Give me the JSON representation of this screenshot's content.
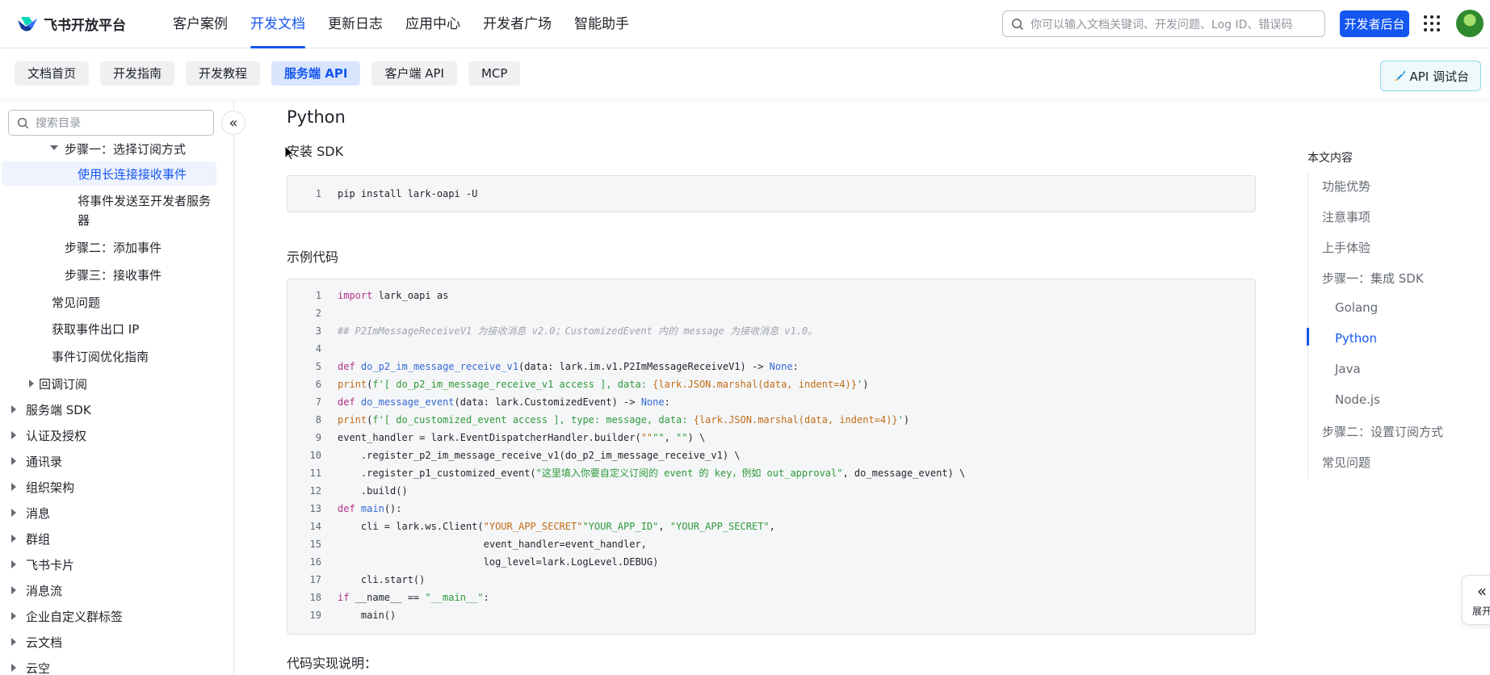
{
  "header": {
    "logo_text": "飞书开放平台",
    "nav": [
      "客户案例",
      "开发文档",
      "更新日志",
      "应用中心",
      "开发者广场",
      "智能助手"
    ],
    "active_nav": "开发文档",
    "search_placeholder": "你可以输入文档关键词、开发问题、Log ID、错误码",
    "console_button": "开发者后台",
    "accent_color": "#1456f0"
  },
  "subnav": {
    "tabs": [
      "文档首页",
      "开发指南",
      "开发教程",
      "服务端 API",
      "客户端 API",
      "MCP"
    ],
    "active_tab": "服务端 API",
    "api_debug_button": "API 调试台"
  },
  "sidebar": {
    "search_placeholder": "搜索目录",
    "items": [
      {
        "label": "步骤一：选择订阅方式",
        "expanded": true
      },
      {
        "label": "使用长连接接收事件",
        "selected": true
      },
      {
        "label": "将事件发送至开发者服务",
        "label_cont": "器"
      },
      {
        "label": "步骤二：添加事件"
      },
      {
        "label": "步骤三：接收事件"
      },
      {
        "label": "常见问题"
      },
      {
        "label": "获取事件出口 IP"
      },
      {
        "label": "事件订阅优化指南"
      },
      {
        "label": "回调订阅"
      },
      {
        "label": "服务端 SDK"
      },
      {
        "label": "认证及授权"
      },
      {
        "label": "通讯录"
      },
      {
        "label": "组织架构"
      },
      {
        "label": "消息"
      },
      {
        "label": "群组"
      },
      {
        "label": "飞书卡片"
      },
      {
        "label": "消息流"
      },
      {
        "label": "企业自定义群标签"
      },
      {
        "label": "云文档"
      },
      {
        "label": "云空"
      }
    ]
  },
  "content": {
    "section_title": "Python",
    "install_heading": "安装 SDK",
    "install_code": [
      {
        "no": "1",
        "text": "pip install lark-oapi -U"
      }
    ],
    "example_heading": "示例代码",
    "example_code": [
      {
        "no": "1",
        "a": "import",
        "b": " lark_oapi ",
        "c": "as",
        "d": " lark"
      },
      {
        "no": "2"
      },
      {
        "no": "3",
        "comment": "## P2ImMessageReceiveV1 为接收消息 v2.0；CustomizedEvent 内的 message 为接收消息 v1.0。"
      },
      {
        "no": "4"
      },
      {
        "no": "5",
        "a": "def",
        "fn": "do_p2_im_message_receive_v1",
        "b": "(data: lark.im.v1.P2ImMessageReceiveV1) -> ",
        "none": "None",
        "c": ":"
      },
      {
        "no": "6",
        "bi": "print",
        "b": "(",
        "s1": "f'[ do_p2_im_message_receive_v1 access ], data: ",
        "s2": "{lark.JSON.marshal(data, indent=4)}",
        "s3": "'",
        "c": ")"
      },
      {
        "no": "7",
        "a": "def",
        "fn": "do_message_event",
        "b": "(data: lark.CustomizedEvent) -> ",
        "none": "None",
        "c": ":"
      },
      {
        "no": "8",
        "bi": "print",
        "b": "(",
        "s1": "f'[ do_customized_event access ], type: message, data: ",
        "s2": "{lark.JSON.marshal(data, indent=4)}",
        "s3": "'",
        "c": ")"
      },
      {
        "no": "9",
        "plain": "event_handler = lark.EventDispatcherHandler.builder(",
        "s": "\"\"",
        "p2": ", ",
        "s2": "\"\"",
        "p3": ") \\"
      },
      {
        "no": "10",
        "plain": "    .register_p2_im_message_receive_v1(do_p2_im_message_receive_v1) \\"
      },
      {
        "no": "11",
        "plain": "    .register_p1_customized_event(",
        "s": "\"这里填入你要自定义订阅的 event 的 key，例如 out_approval\"",
        "p2": ", do_message_event) \\"
      },
      {
        "no": "12",
        "plain": "    .build()"
      },
      {
        "no": "13",
        "a": "def",
        "fn": "main",
        "b": "():"
      },
      {
        "no": "14",
        "plain": "    cli = lark.ws.Client(",
        "s": "\"YOUR_APP_ID\"",
        "p2": ", ",
        "s2": "\"YOUR_APP_SECRET\"",
        "p3": ","
      },
      {
        "no": "15",
        "plain": "                         event_handler=event_handler,"
      },
      {
        "no": "16",
        "plain": "                         log_level=lark.LogLevel.DEBUG)"
      },
      {
        "no": "17",
        "plain": "    cli.start()"
      },
      {
        "no": "18",
        "a": "if",
        "b": " __name__ == ",
        "s": "\"__main__\"",
        "c": ":"
      },
      {
        "no": "19",
        "plain": "    main()"
      }
    ],
    "impl_heading": "代码实现说明："
  },
  "toc": {
    "title": "本文内容",
    "items": [
      "功能优势",
      "注意事项",
      "上手体验",
      "步骤一：集成 SDK",
      "Golang",
      "Python",
      "Java",
      "Node.js",
      "步骤二：设置订阅方式",
      "常见问题"
    ],
    "active": "Python"
  },
  "float_button": {
    "label": "展开"
  }
}
